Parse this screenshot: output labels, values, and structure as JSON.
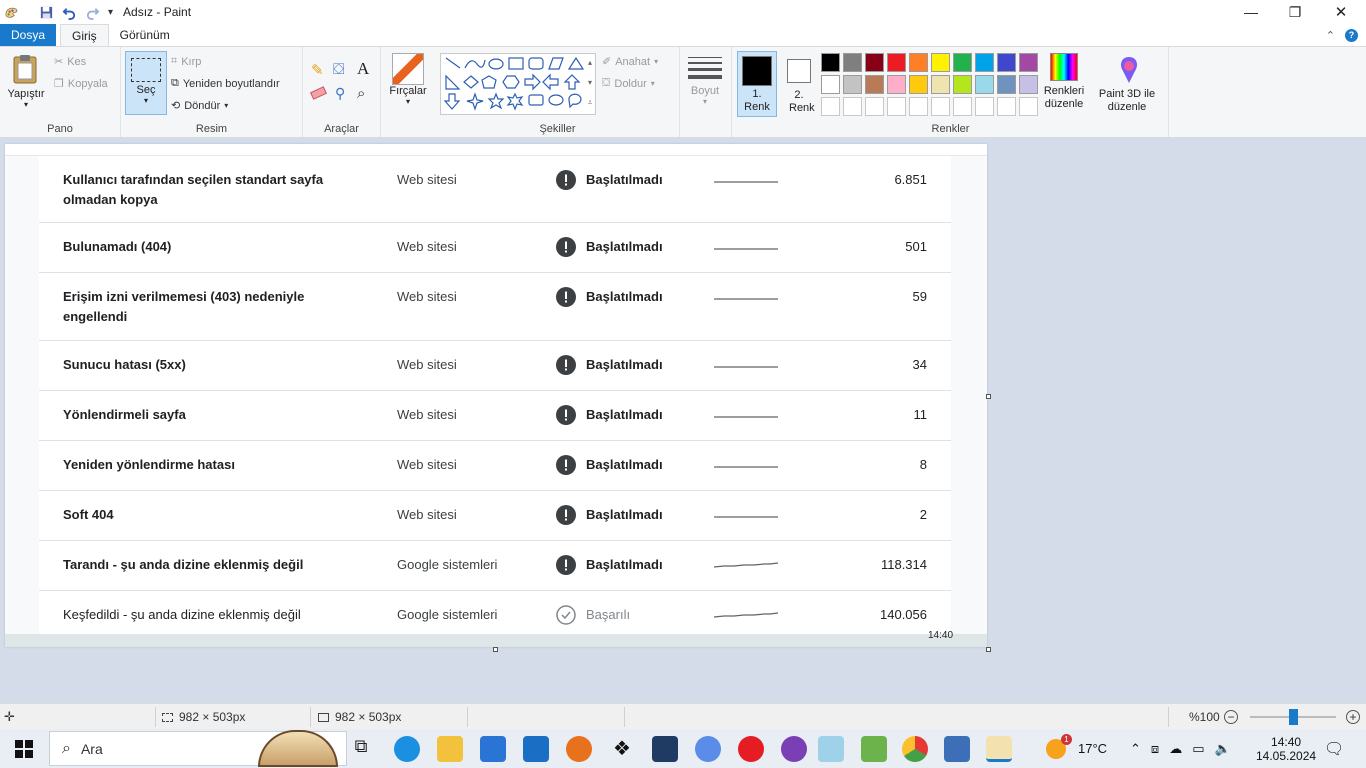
{
  "window": {
    "title": "Adsız - Paint",
    "controls": {
      "minimize": "—",
      "maximize": "❐",
      "close": "✕"
    }
  },
  "menu": {
    "file": "Dosya",
    "tabs": [
      "Giriş",
      "Görünüm"
    ]
  },
  "ribbon": {
    "clipboard": {
      "paste": "Yapıştır",
      "cut": "Kes",
      "copy": "Kopyala",
      "label": "Pano"
    },
    "image": {
      "select": "Seç",
      "crop": "Kırp",
      "resize": "Yeniden boyutlandır",
      "rotate": "Döndür",
      "label": "Resim"
    },
    "tools": {
      "label": "Araçlar"
    },
    "brushes": {
      "label": "Fırçalar"
    },
    "shapes": {
      "outline": "Anahat",
      "fill": "Doldur",
      "label": "Şekiller"
    },
    "size": {
      "label": "Boyut"
    },
    "colors": {
      "color1": "1. Renk",
      "color2": "2. Renk",
      "edit": "Renkleri düzenle",
      "label": "Renkler",
      "color1_value": "#000000",
      "color2_value": "#ffffff",
      "row1": [
        "#000000",
        "#7f7f7f",
        "#880015",
        "#ed1c24",
        "#ff7f27",
        "#fff200",
        "#22b14c",
        "#00a2e8",
        "#3f48cc",
        "#a349a4"
      ],
      "row2": [
        "#ffffff",
        "#c3c3c3",
        "#b97a57",
        "#ffaec9",
        "#ffc90e",
        "#efe4b0",
        "#b5e61d",
        "#99d9ea",
        "#7092be",
        "#c8bfe7"
      ]
    },
    "paint3d": "Paint 3D ile düzenle"
  },
  "table": {
    "rows": [
      {
        "reason": "Kullanıcı tarafından seçilen standart sayfa olmadan kopya",
        "source": "Web sitesi",
        "status": "Başlatılmadı",
        "count": "6.851"
      },
      {
        "reason": "Bulunamadı (404)",
        "source": "Web sitesi",
        "status": "Başlatılmadı",
        "count": "501"
      },
      {
        "reason": "Erişim izni verilmemesi (403) nedeniyle engellendi",
        "source": "Web sitesi",
        "status": "Başlatılmadı",
        "count": "59"
      },
      {
        "reason": "Sunucu hatası (5xx)",
        "source": "Web sitesi",
        "status": "Başlatılmadı",
        "count": "34"
      },
      {
        "reason": "Yönlendirmeli sayfa",
        "source": "Web sitesi",
        "status": "Başlatılmadı",
        "count": "11"
      },
      {
        "reason": "Yeniden yönlendirme hatası",
        "source": "Web sitesi",
        "status": "Başlatılmadı",
        "count": "8"
      },
      {
        "reason": "Soft 404",
        "source": "Web sitesi",
        "status": "Başlatılmadı",
        "count": "2"
      },
      {
        "reason": "Tarandı - şu anda dizine eklenmiş değil",
        "source": "Google sistemleri",
        "status": "Başlatılmadı",
        "count": "118.314"
      },
      {
        "reason": "Keşfedildi - şu anda dizine eklenmiş değil",
        "source": "Google sistemleri",
        "status": "Başarılı",
        "count": "140.056"
      }
    ],
    "captured_clock": "14:40"
  },
  "statusbar": {
    "selection_size": "982 × 503px",
    "canvas_size": "982 × 503px",
    "zoom": "%100",
    "zoom_level": 0.5
  },
  "taskbar": {
    "search_placeholder": "Ara",
    "weather_temp": "17°C",
    "weather_badge": "1",
    "time": "14:40",
    "date": "14.05.2024"
  }
}
